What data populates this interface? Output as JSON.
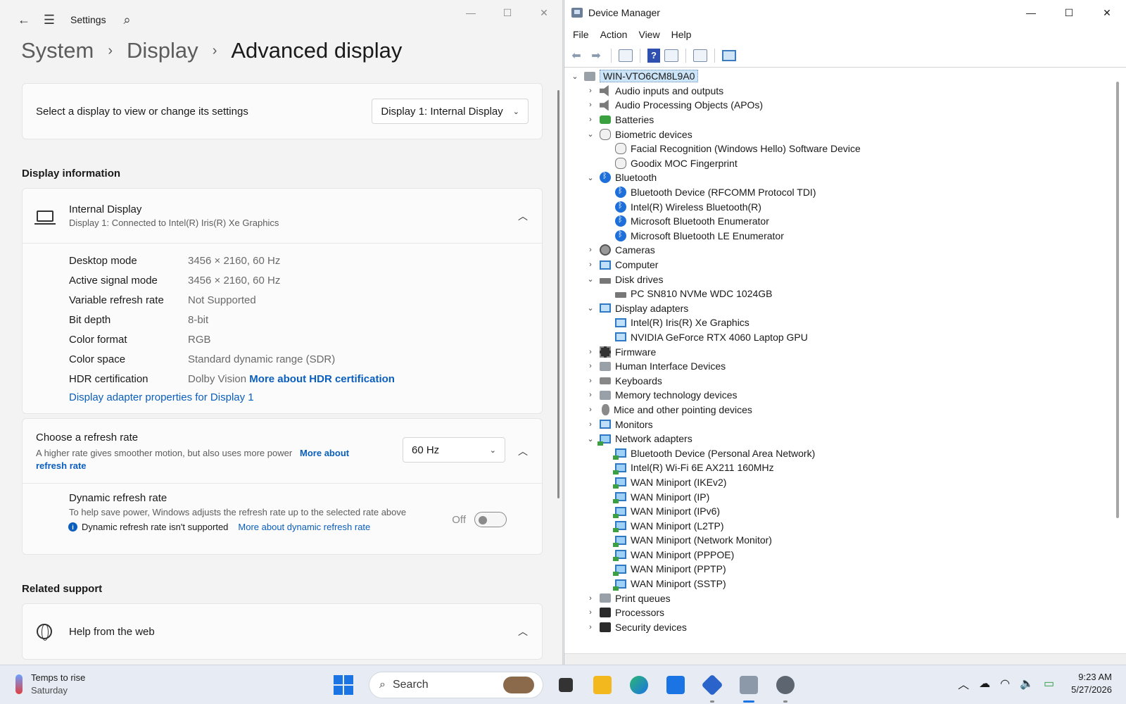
{
  "settings": {
    "app_name": "Settings",
    "breadcrumb": [
      "System",
      "Display",
      "Advanced display"
    ],
    "select_label": "Select a display to view or change its settings",
    "select_value": "Display 1: Internal Display",
    "display_info_title": "Display information",
    "display_name": "Internal Display",
    "display_sub": "Display 1: Connected to Intel(R) Iris(R) Xe Graphics",
    "rows": [
      {
        "k": "Desktop mode",
        "v": "3456 × 2160, 60 Hz"
      },
      {
        "k": "Active signal mode",
        "v": "3456 × 2160, 60 Hz"
      },
      {
        "k": "Variable refresh rate",
        "v": "Not Supported"
      },
      {
        "k": "Bit depth",
        "v": "8-bit"
      },
      {
        "k": "Color format",
        "v": "RGB"
      },
      {
        "k": "Color space",
        "v": "Standard dynamic range (SDR)"
      },
      {
        "k": "HDR certification",
        "v": "Dolby Vision"
      }
    ],
    "hdr_link": "More about HDR certification",
    "adapter_link": "Display adapter properties for Display 1",
    "refresh_title": "Choose a refresh rate",
    "refresh_desc": "A higher rate gives smoother motion, but also uses more power",
    "refresh_link": "More about refresh rate",
    "refresh_value": "60 Hz",
    "dyn_title": "Dynamic refresh rate",
    "dyn_desc": "To help save power, Windows adjusts the refresh rate up to the selected rate above",
    "dyn_note": "Dynamic refresh rate isn't supported",
    "dyn_link": "More about dynamic refresh rate",
    "dyn_state": "Off",
    "related_title": "Related support",
    "help_title": "Help from the web"
  },
  "dm": {
    "title": "Device Manager",
    "menu": [
      "File",
      "Action",
      "View",
      "Help"
    ],
    "root": "WIN-VTO6CM8L9A0",
    "nodes": [
      {
        "lvl": 1,
        "exp": "›",
        "ic": "spk",
        "t": "Audio inputs and outputs"
      },
      {
        "lvl": 1,
        "exp": "›",
        "ic": "spk",
        "t": "Audio Processing Objects (APOs)"
      },
      {
        "lvl": 1,
        "exp": "›",
        "ic": "bat",
        "t": "Batteries"
      },
      {
        "lvl": 1,
        "exp": "⌄",
        "ic": "fp",
        "t": "Biometric devices"
      },
      {
        "lvl": 2,
        "exp": "",
        "ic": "fp",
        "t": "Facial Recognition (Windows Hello) Software Device"
      },
      {
        "lvl": 2,
        "exp": "",
        "ic": "fp",
        "t": "Goodix MOC Fingerprint"
      },
      {
        "lvl": 1,
        "exp": "⌄",
        "ic": "bt",
        "t": "Bluetooth"
      },
      {
        "lvl": 2,
        "exp": "",
        "ic": "bt",
        "t": "Bluetooth Device (RFCOMM Protocol TDI)"
      },
      {
        "lvl": 2,
        "exp": "",
        "ic": "bt",
        "t": "Intel(R) Wireless Bluetooth(R)"
      },
      {
        "lvl": 2,
        "exp": "",
        "ic": "bt",
        "t": "Microsoft Bluetooth Enumerator"
      },
      {
        "lvl": 2,
        "exp": "",
        "ic": "bt",
        "t": "Microsoft Bluetooth LE Enumerator"
      },
      {
        "lvl": 1,
        "exp": "›",
        "ic": "cam",
        "t": "Cameras"
      },
      {
        "lvl": 1,
        "exp": "›",
        "ic": "mon",
        "t": "Computer"
      },
      {
        "lvl": 1,
        "exp": "⌄",
        "ic": "disk",
        "t": "Disk drives"
      },
      {
        "lvl": 2,
        "exp": "",
        "ic": "disk",
        "t": "PC SN810 NVMe WDC 1024GB"
      },
      {
        "lvl": 1,
        "exp": "⌄",
        "ic": "mon",
        "t": "Display adapters"
      },
      {
        "lvl": 2,
        "exp": "",
        "ic": "mon",
        "t": "Intel(R) Iris(R) Xe Graphics"
      },
      {
        "lvl": 2,
        "exp": "",
        "ic": "mon",
        "t": "NVIDIA GeForce RTX 4060 Laptop GPU"
      },
      {
        "lvl": 1,
        "exp": "›",
        "ic": "chip",
        "t": "Firmware"
      },
      {
        "lvl": 1,
        "exp": "›",
        "ic": "gray",
        "t": "Human Interface Devices"
      },
      {
        "lvl": 1,
        "exp": "›",
        "ic": "kbd",
        "t": "Keyboards"
      },
      {
        "lvl": 1,
        "exp": "›",
        "ic": "gray",
        "t": "Memory technology devices"
      },
      {
        "lvl": 1,
        "exp": "›",
        "ic": "mouse",
        "t": "Mice and other pointing devices"
      },
      {
        "lvl": 1,
        "exp": "›",
        "ic": "mon",
        "t": "Monitors"
      },
      {
        "lvl": 1,
        "exp": "⌄",
        "ic": "net",
        "t": "Network adapters"
      },
      {
        "lvl": 2,
        "exp": "",
        "ic": "net",
        "t": "Bluetooth Device (Personal Area Network)"
      },
      {
        "lvl": 2,
        "exp": "",
        "ic": "net",
        "t": "Intel(R) Wi-Fi 6E AX211 160MHz"
      },
      {
        "lvl": 2,
        "exp": "",
        "ic": "net",
        "t": "WAN Miniport (IKEv2)"
      },
      {
        "lvl": 2,
        "exp": "",
        "ic": "net",
        "t": "WAN Miniport (IP)"
      },
      {
        "lvl": 2,
        "exp": "",
        "ic": "net",
        "t": "WAN Miniport (IPv6)"
      },
      {
        "lvl": 2,
        "exp": "",
        "ic": "net",
        "t": "WAN Miniport (L2TP)"
      },
      {
        "lvl": 2,
        "exp": "",
        "ic": "net",
        "t": "WAN Miniport (Network Monitor)"
      },
      {
        "lvl": 2,
        "exp": "",
        "ic": "net",
        "t": "WAN Miniport (PPPOE)"
      },
      {
        "lvl": 2,
        "exp": "",
        "ic": "net",
        "t": "WAN Miniport (PPTP)"
      },
      {
        "lvl": 2,
        "exp": "",
        "ic": "net",
        "t": "WAN Miniport (SSTP)"
      },
      {
        "lvl": 1,
        "exp": "›",
        "ic": "gray",
        "t": "Print queues"
      },
      {
        "lvl": 1,
        "exp": "›",
        "ic": "dark",
        "t": "Processors"
      },
      {
        "lvl": 1,
        "exp": "›",
        "ic": "dark",
        "t": "Security devices"
      }
    ]
  },
  "taskbar": {
    "weather_title": "Temps to rise",
    "weather_day": "Saturday",
    "search_placeholder": "Search",
    "time": "9:23 AM",
    "date": "5/27/2026"
  },
  "icons": {
    "back": "back-arrow-icon",
    "menu": "hamburger-icon",
    "search": "search-icon"
  }
}
